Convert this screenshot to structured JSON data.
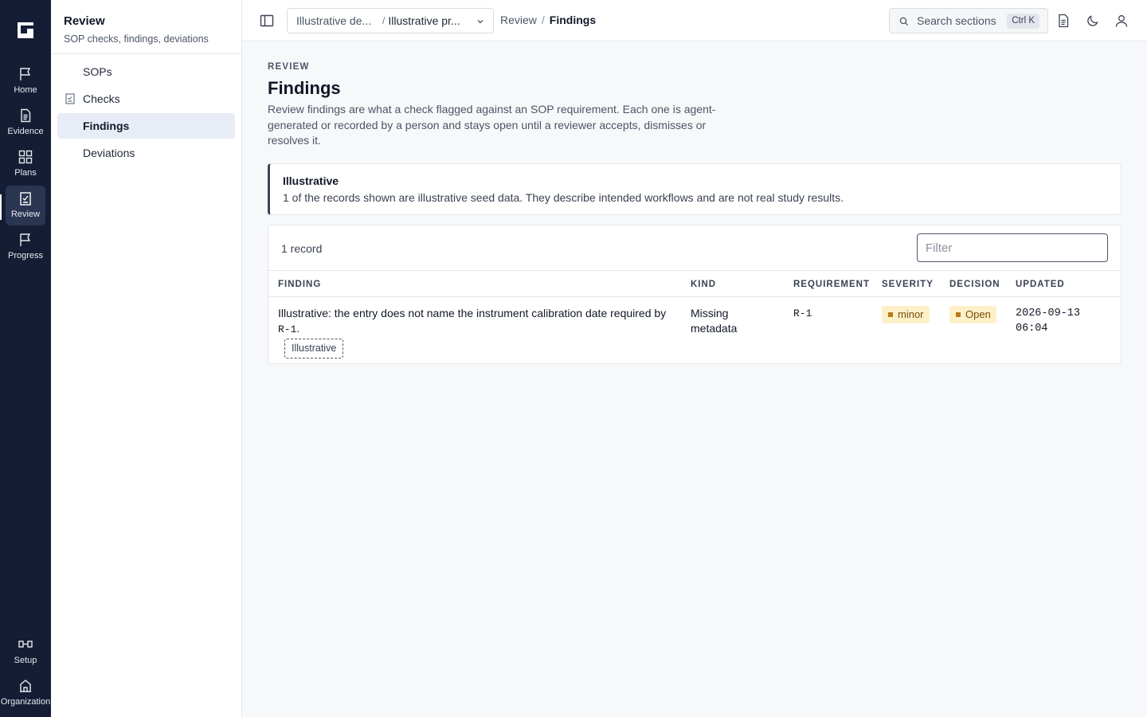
{
  "rail": {
    "items": [
      {
        "label": "Home",
        "icon": "flag-icon"
      },
      {
        "label": "Evidence",
        "icon": "document-icon"
      },
      {
        "label": "Plans",
        "icon": "grid-icon"
      },
      {
        "label": "Review",
        "icon": "clipboard-check-icon",
        "active": true
      },
      {
        "label": "Progress",
        "icon": "flag-icon"
      }
    ],
    "bottom": [
      {
        "label": "Setup",
        "icon": "link-icon"
      },
      {
        "label": "Organization",
        "icon": "building-icon"
      }
    ]
  },
  "sidebar": {
    "title": "Review",
    "subtitle": "SOP checks, findings, deviations",
    "items": [
      {
        "label": "SOPs"
      },
      {
        "label": "Checks",
        "icon": "checklist-icon"
      },
      {
        "label": "Findings",
        "active": true
      },
      {
        "label": "Deviations"
      }
    ]
  },
  "topbar": {
    "context_a": "Illustrative de...",
    "context_sep": "/",
    "context_b": "Illustrative pr...",
    "breadcrumb": [
      "Review",
      "Findings"
    ],
    "search_placeholder": "Search sections",
    "search_shortcut": "Ctrl K"
  },
  "page": {
    "eyebrow": "REVIEW",
    "title": "Findings",
    "description": "Review findings are what a check flagged against an SOP requirement. Each one is agent-generated or recorded by a person and stays open until a reviewer accepts, dismisses or resolves it."
  },
  "notice": {
    "title": "Illustrative",
    "body": "1 of the records shown are illustrative seed data. They describe intended workflows and are not real study results."
  },
  "table": {
    "count": "1 record",
    "filter_placeholder": "Filter",
    "headers": [
      "FINDING",
      "KIND",
      "REQUIREMENT",
      "SEVERITY",
      "DECISION",
      "UPDATED"
    ],
    "rows": [
      {
        "finding_pre": "Illustrative: the entry does not name the instrument calibration date required by",
        "finding_ref": "R-1",
        "finding_post": ".",
        "tag": "Illustrative",
        "kind": "Missing metadata",
        "requirement": "R-1",
        "severity": "minor",
        "decision": "Open",
        "updated": "2026-09-13 06:04"
      }
    ]
  },
  "colors": {
    "rail_bg": "#141d33",
    "badge_bg": "#fdf0c8",
    "badge_text": "#7a4d06"
  }
}
